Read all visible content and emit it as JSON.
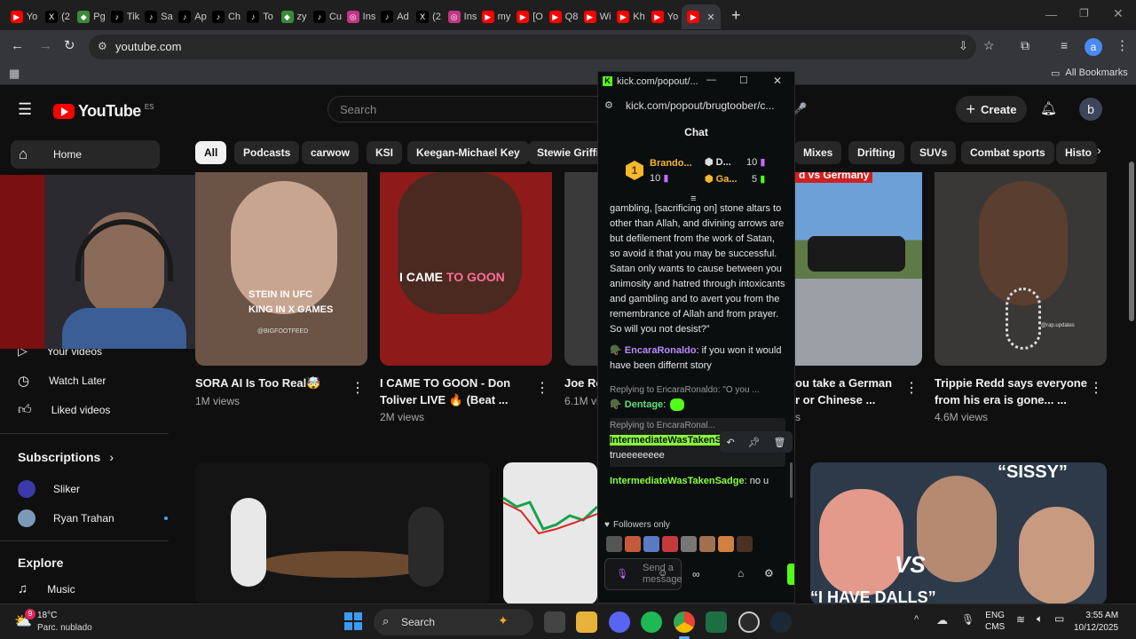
{
  "browser": {
    "tabs": [
      {
        "label": "Yo",
        "color": "#ff0000",
        "glyph": "▶"
      },
      {
        "label": "(2",
        "color": "#000000",
        "glyph": "X"
      },
      {
        "label": "Pg",
        "color": "#3a8a3a",
        "glyph": "◆"
      },
      {
        "label": "Tik",
        "color": "#000000",
        "glyph": "♪"
      },
      {
        "label": "Sa",
        "color": "#000000",
        "glyph": "♪"
      },
      {
        "label": "Ap",
        "color": "#000000",
        "glyph": "♪"
      },
      {
        "label": "Ch",
        "color": "#000000",
        "glyph": "♪"
      },
      {
        "label": "To",
        "color": "#000000",
        "glyph": "♪"
      },
      {
        "label": "zy",
        "color": "#3a8a3a",
        "glyph": "◆"
      },
      {
        "label": "Cu",
        "color": "#000000",
        "glyph": "♪"
      },
      {
        "label": "Ins",
        "color": "#c13584",
        "glyph": "◎"
      },
      {
        "label": "Ad",
        "color": "#000000",
        "glyph": "♪"
      },
      {
        "label": "(2",
        "color": "#000000",
        "glyph": "X"
      },
      {
        "label": "Ins",
        "color": "#c13584",
        "glyph": "◎"
      },
      {
        "label": "my",
        "color": "#ff0000",
        "glyph": "▶"
      },
      {
        "label": "[O",
        "color": "#ff0000",
        "glyph": "▶"
      },
      {
        "label": "Q8",
        "color": "#ff0000",
        "glyph": "▶"
      },
      {
        "label": "Wi",
        "color": "#ff0000",
        "glyph": "▶"
      },
      {
        "label": "Kh",
        "color": "#ff0000",
        "glyph": "▶"
      },
      {
        "label": "Yo",
        "color": "#ff0000",
        "glyph": "▶"
      },
      {
        "label": "",
        "color": "#ff0000",
        "glyph": "▶"
      }
    ],
    "new_tab": "+",
    "url": "youtube.com",
    "bookmarks_label": "All Bookmarks",
    "profile_letter": "a"
  },
  "youtube": {
    "logo_text": "YouTube",
    "region": "ES",
    "search_placeholder": "Search",
    "create_label": "Create",
    "avatar_letter": "b",
    "chips": [
      "All",
      "Podcasts",
      "carwow",
      "KSI",
      "Keegan-Michael Key",
      "Stewie Griffin",
      "Mixes",
      "Drifting",
      "SUVs",
      "Combat sports",
      "Histo"
    ],
    "sidebar": {
      "home": "Home",
      "your_videos": "Your videos",
      "watch_later": "Watch Later",
      "liked_videos": "Liked videos",
      "subscriptions_heading": "Subscriptions",
      "subs": [
        "Sliker",
        "Ryan Trahan"
      ],
      "explore_heading": "Explore",
      "music": "Music"
    },
    "videos": [
      {
        "title_line1": "SORA AI Is Too Real🤯",
        "title_line2": "",
        "meta": "1M views",
        "overlay": "STEIN IN UFC\nKING IN X GAMES",
        "watermark": "@BIGFOOTFEED"
      },
      {
        "title_line1": "I CAME TO GOON - Don",
        "title_line2": "Toliver LIVE 🔥 (Beat ...",
        "meta": "2M views",
        "overlay_a": "I CAME",
        "overlay_b": "TO GOON"
      },
      {
        "title_line1": "Joe Ro",
        "title_line2": "",
        "meta": "6.1M vi"
      },
      {
        "title_line1": "ou take a German",
        "title_line2": "r or Chinese ...",
        "meta": "s",
        "overlay": "d vs Germany"
      },
      {
        "title_line1": "Trippie Redd says everyone",
        "title_line2": "from his era is gone... ...",
        "meta": "4.6M views",
        "watermark": "@rap.updates"
      },
      {
        "overlay": "“SISSY”",
        "overlay_vs": "VS",
        "overlay_bottom": "“I HAVE DALLS”"
      }
    ]
  },
  "kick": {
    "window_title": "kick.com/popout/...",
    "url": "kick.com/popout/brugtoober/c...",
    "heading": "Chat",
    "leaderboard": [
      {
        "rank": "1",
        "name": "Brando...",
        "count": "10"
      },
      {
        "name": "D...",
        "count": "10"
      },
      {
        "name": "Ga...",
        "count": "5"
      }
    ],
    "quote": "gambling, [sacrificing on] stone altars to other than Allah, and divining arrows are but defilement from the work of Satan, so avoid it that you may be successful. Satan only wants to cause between you animosity and hatred through intoxicants and gambling and to avert you from the remembrance of Allah and from prayer. So will you not desist?”",
    "messages": [
      {
        "user": "EncaraRonaldo",
        "text": ": if you won it would have been differnt story",
        "color": "#b78cff"
      },
      {
        "reply": "Replying to EncaraRonaldo: \"O you ...",
        "user": "Dentage",
        "text": ":",
        "color": "#5ee07c"
      },
      {
        "reply": "Replying to EncaraRonal...",
        "user": "IntermediateWasTakenSadge",
        "text": ": trueeeeeeee",
        "color": "#8aff3a"
      },
      {
        "user": "IntermediateWasTakenSadge",
        "text": ": no u",
        "color": "#8aff3a"
      }
    ],
    "followers_only": "Followers only",
    "send_placeholder": "Send a message"
  },
  "taskbar": {
    "weather_temp": "18°C",
    "weather_desc": "Parc. nublado",
    "weather_badge": "9",
    "search_label": "Search",
    "lang_top": "ENG",
    "lang_bottom": "CMS",
    "time": "3:55 AM",
    "date": "10/12/2025"
  }
}
